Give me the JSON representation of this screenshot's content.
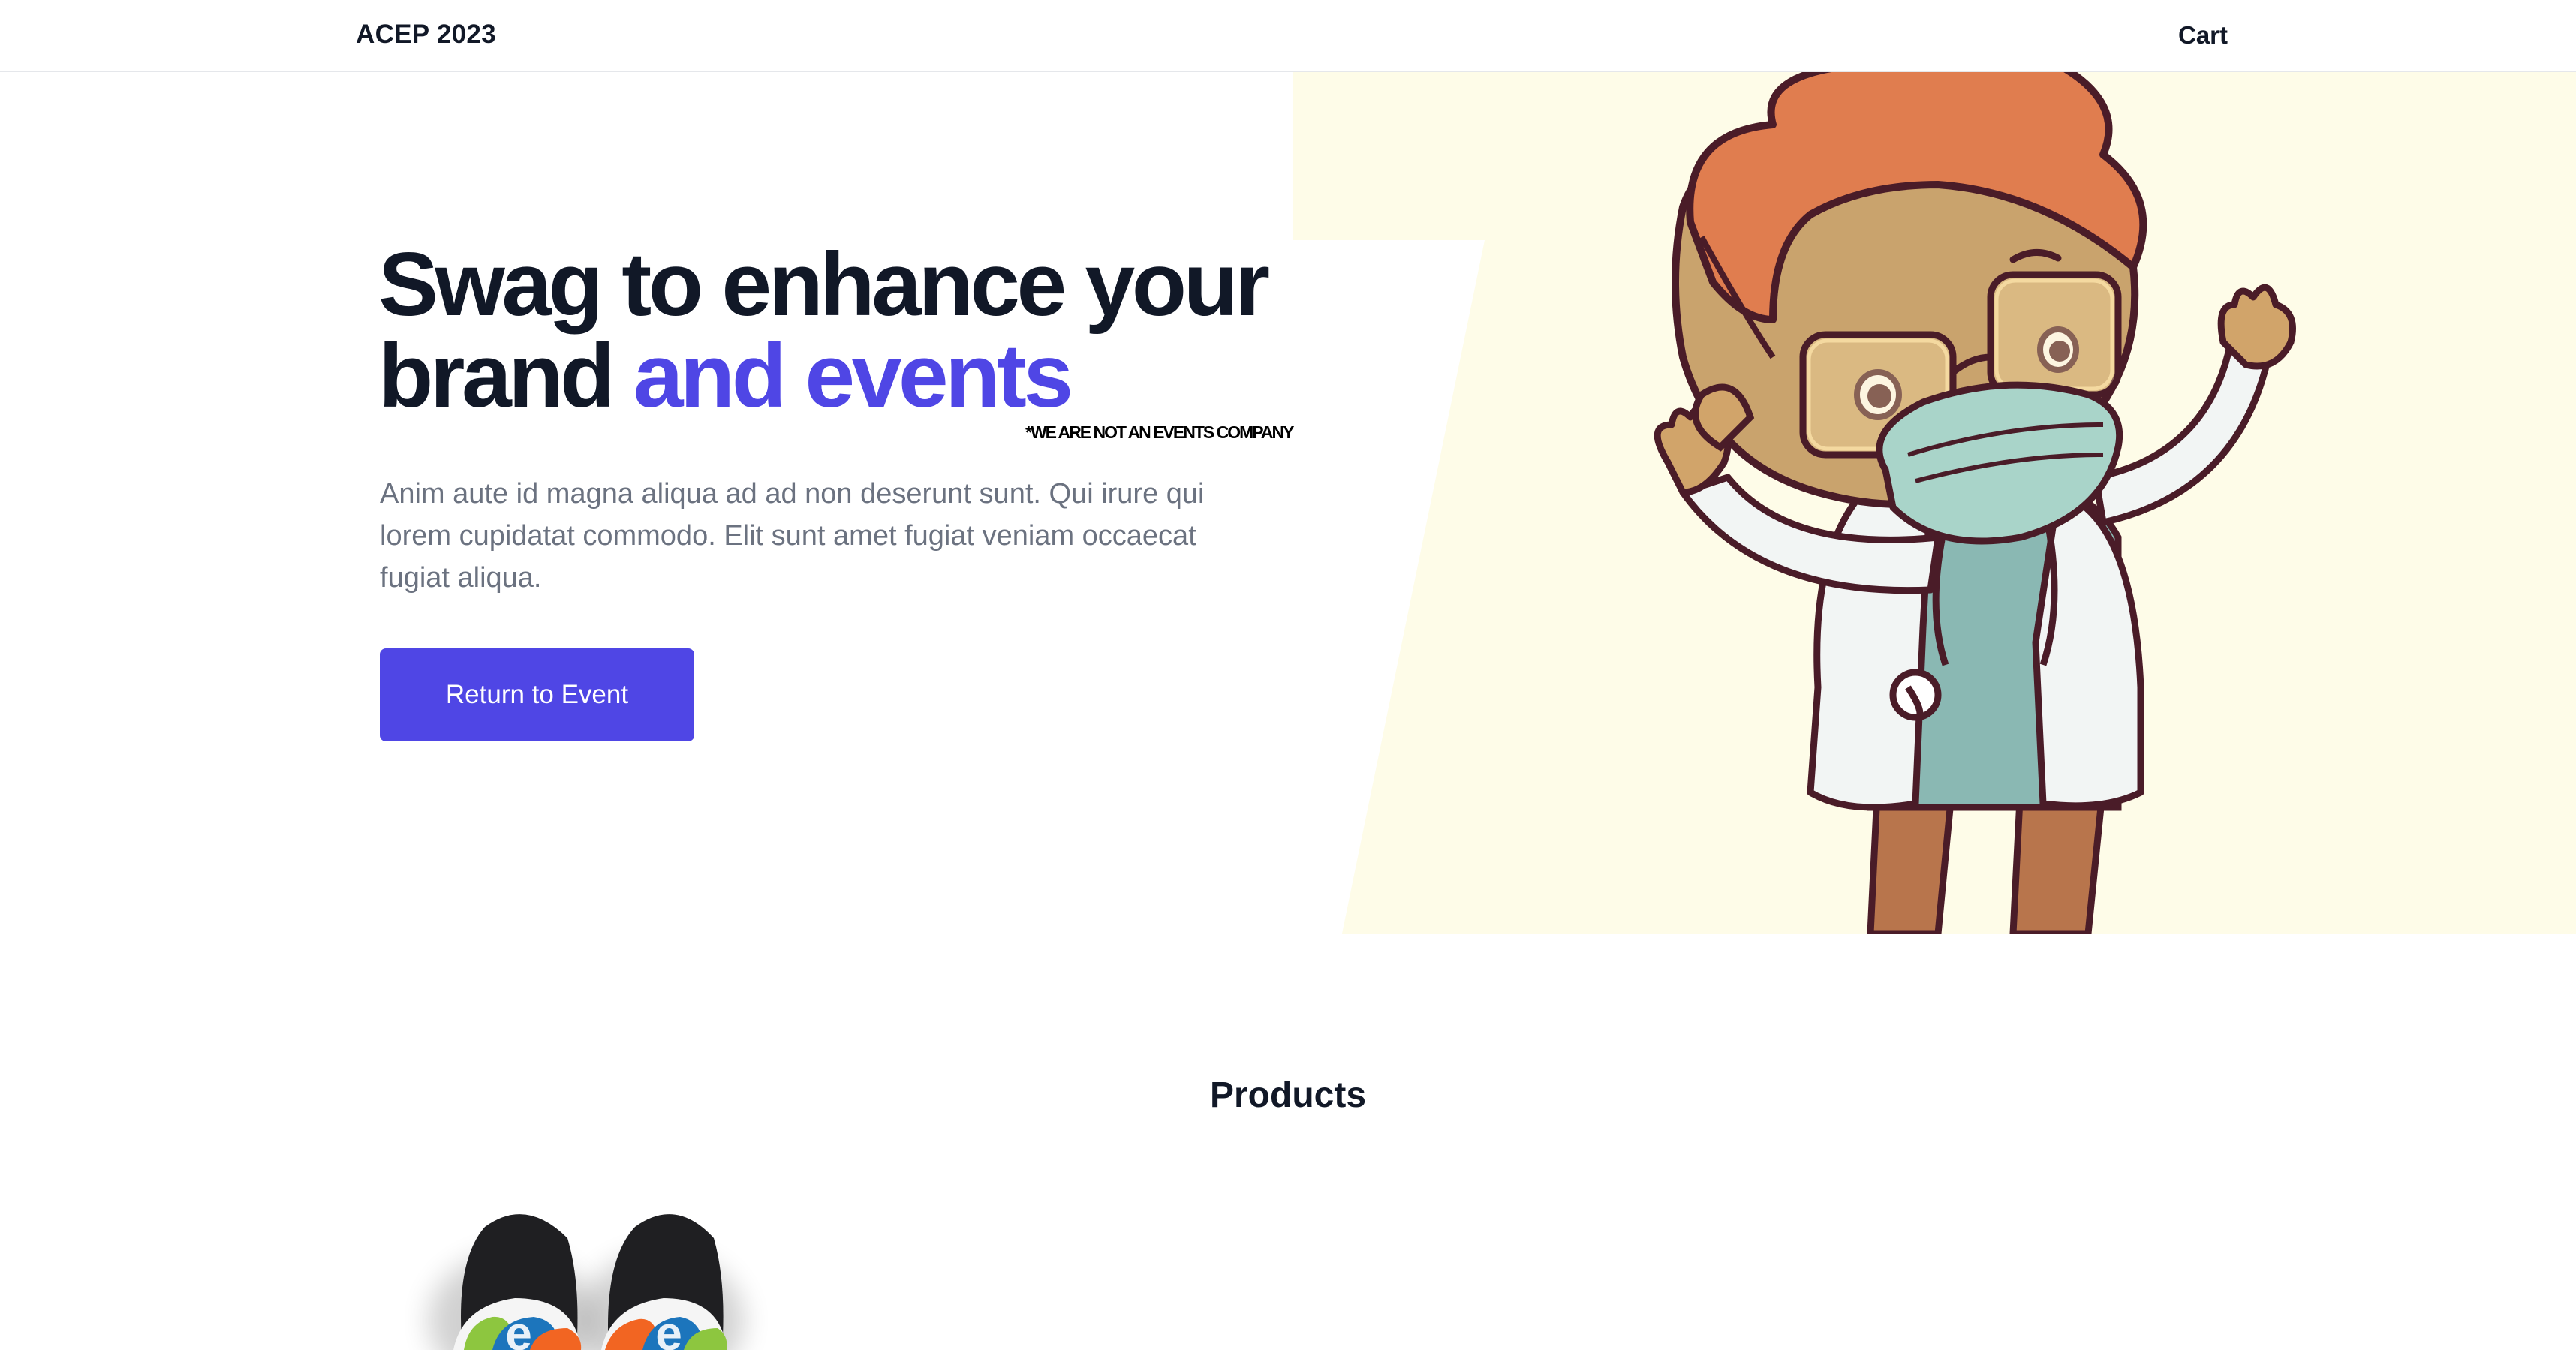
{
  "header": {
    "brand": "ACEP 2023",
    "cart_label": "Cart"
  },
  "hero": {
    "title_main": "Swag to enhance your brand ",
    "title_accent": "and events",
    "disclaimer": "*WE ARE NOT AN EVENTS COMPANY",
    "body": "Anim aute id magna aliqua ad ad non deserunt sunt. Qui irure qui lorem cupidatat commodo. Elit sunt amet fugiat veniam occaecat fugiat aliqua.",
    "cta_label": "Return to Event",
    "illustration": "doctor-mascot-illustration"
  },
  "products": {
    "heading": "Products",
    "items": [
      {
        "image": "slide-sandals-product-image"
      }
    ]
  },
  "colors": {
    "accent": "#4f46e5",
    "hero_panel": "#fefce8",
    "heading_text": "#111827",
    "body_text": "#6b7280"
  }
}
